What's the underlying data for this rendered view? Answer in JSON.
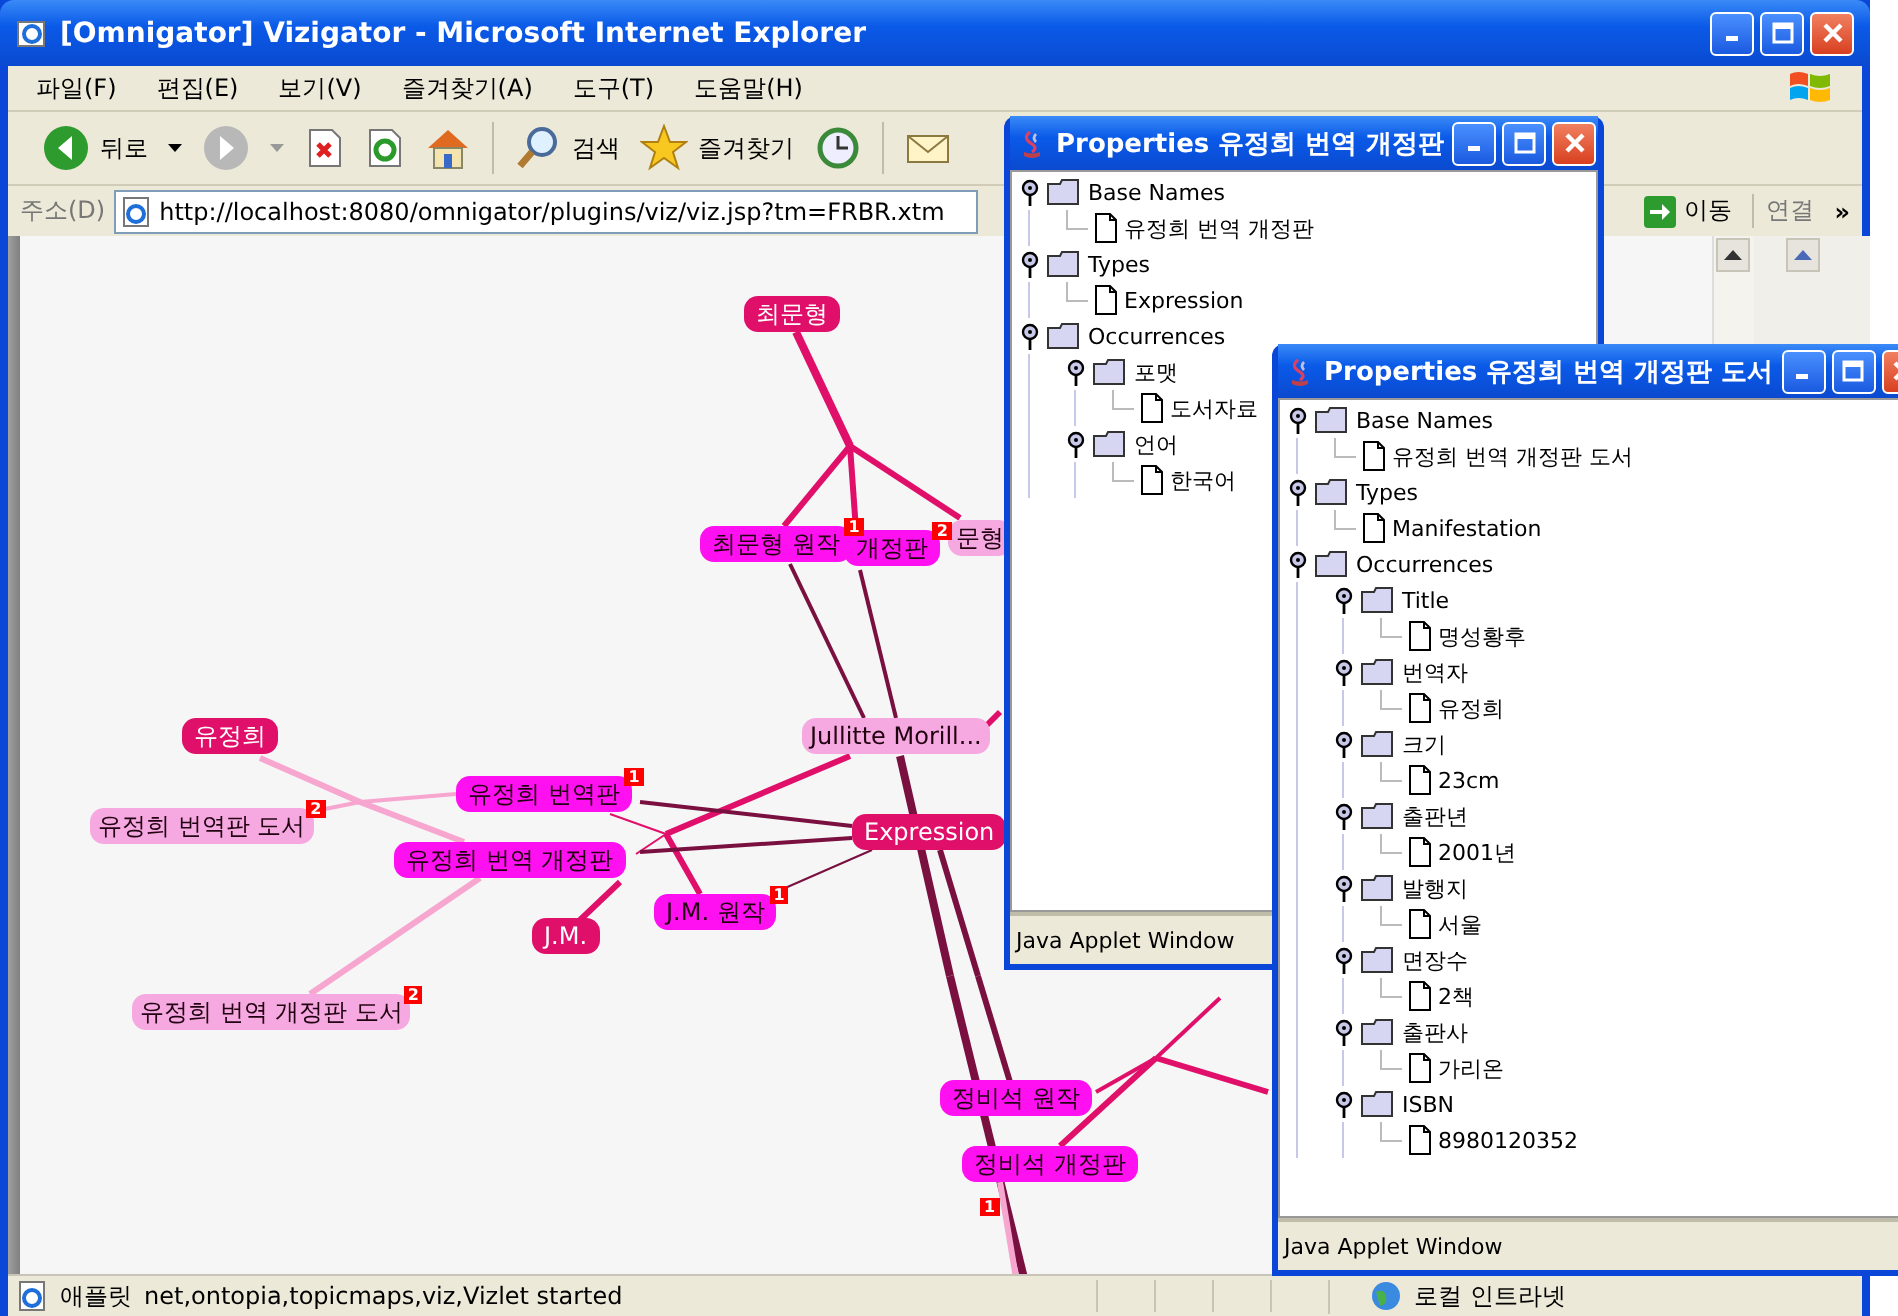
{
  "window": {
    "title": "[Omnigator] Vizigator - Microsoft Internet Explorer"
  },
  "menu": [
    "파일(F)",
    "편집(E)",
    "보기(V)",
    "즐겨찾기(A)",
    "도구(T)",
    "도움말(H)"
  ],
  "toolbar": [
    {
      "kind": "back",
      "label": "뒤로"
    },
    {
      "kind": "forward"
    },
    {
      "kind": "stop"
    },
    {
      "kind": "refresh"
    },
    {
      "kind": "home"
    },
    {
      "kind": "search",
      "label": "검색"
    },
    {
      "kind": "favorites",
      "label": "즐겨찾기"
    },
    {
      "kind": "history"
    },
    {
      "kind": "mail"
    }
  ],
  "address": {
    "label": "주소(D)",
    "value": "http://localhost:8080/omnigator/plugins/viz/viz.jsp?tm=FRBR.xtm",
    "go": "이동",
    "links": "연결",
    "more": "»"
  },
  "graph": {
    "nodes": [
      {
        "label": "최문형",
        "kind": "topic"
      },
      {
        "label": "최문형 원작",
        "kind": "work",
        "badge": "1"
      },
      {
        "label": "개정판",
        "kind": "work",
        "badge": "2"
      },
      {
        "label": "문형",
        "kind": "item"
      },
      {
        "label": "유정희",
        "kind": "topic"
      },
      {
        "label": "Jullitte Morill...",
        "kind": "item"
      },
      {
        "label": "유정희 번역판 도서",
        "kind": "item",
        "badge": "2"
      },
      {
        "label": "유정희 번역판",
        "kind": "work",
        "badge": "1"
      },
      {
        "label": "유정희 번역 개정판",
        "kind": "work"
      },
      {
        "label": "Expression",
        "kind": "topic"
      },
      {
        "label": "J.M. 원작",
        "kind": "work",
        "badge": "1"
      },
      {
        "label": "J.M.",
        "kind": "topic"
      },
      {
        "label": "유정희 번역 개정판 도서",
        "kind": "item",
        "badge": "2"
      },
      {
        "label": "정비석 원작",
        "kind": "work"
      },
      {
        "label": "정비석 개정판",
        "kind": "work"
      }
    ],
    "loose_badges": [
      "1"
    ]
  },
  "popups": [
    {
      "title": "Properties 유정희 번역 개정판",
      "footer": "Java Applet Window",
      "tree": [
        {
          "label": "Base Names",
          "children": [
            {
              "label": "유정희 번역 개정판"
            }
          ]
        },
        {
          "label": "Types",
          "children": [
            {
              "label": "Expression"
            }
          ]
        },
        {
          "label": "Occurrences",
          "children": [
            {
              "label": "포맷",
              "children": [
                {
                  "label": "도서자료"
                }
              ]
            },
            {
              "label": "언어",
              "children": [
                {
                  "label": "한국어"
                }
              ]
            }
          ]
        }
      ]
    },
    {
      "title": "Properties 유정희 번역 개정판 도서",
      "footer": "Java Applet Window",
      "tree": [
        {
          "label": "Base Names",
          "children": [
            {
              "label": "유정희 번역 개정판 도서"
            }
          ]
        },
        {
          "label": "Types",
          "children": [
            {
              "label": "Manifestation"
            }
          ]
        },
        {
          "label": "Occurrences",
          "children": [
            {
              "label": "Title",
              "children": [
                {
                  "label": "명성황후"
                }
              ]
            },
            {
              "label": "번역자",
              "children": [
                {
                  "label": "유정희"
                }
              ]
            },
            {
              "label": "크기",
              "children": [
                {
                  "label": "23cm"
                }
              ]
            },
            {
              "label": "출판년",
              "children": [
                {
                  "label": "2001년"
                }
              ]
            },
            {
              "label": "발행지",
              "children": [
                {
                  "label": "서울"
                }
              ]
            },
            {
              "label": "면장수",
              "children": [
                {
                  "label": "2책"
                }
              ]
            },
            {
              "label": "출판사",
              "children": [
                {
                  "label": "가리온"
                }
              ]
            },
            {
              "label": "ISBN",
              "children": [
                {
                  "label": "8980120352"
                }
              ]
            }
          ]
        }
      ]
    }
  ],
  "status_bar": {
    "label": "애플릿",
    "message": "net,ontopia,topicmaps,viz,Vizlet started",
    "zone": "로컬 인트라넷"
  }
}
